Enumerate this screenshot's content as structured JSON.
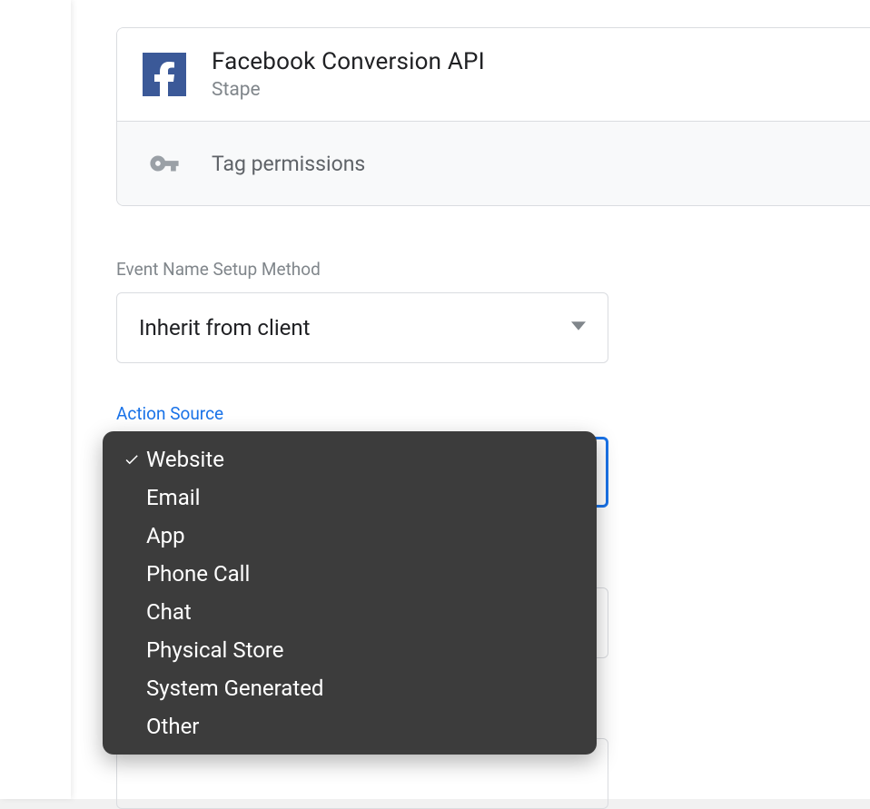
{
  "header": {
    "title": "Facebook Conversion API",
    "subtitle": "Stape",
    "permissions_label": "Tag permissions"
  },
  "event_name_setup": {
    "label": "Event Name Setup Method",
    "value": "Inherit from client"
  },
  "action_source": {
    "label": "Action Source",
    "selected": "Website",
    "options": [
      {
        "label": "Website",
        "selected": true
      },
      {
        "label": "Email",
        "selected": false
      },
      {
        "label": "App",
        "selected": false
      },
      {
        "label": "Phone Call",
        "selected": false
      },
      {
        "label": "Chat",
        "selected": false
      },
      {
        "label": "Physical Store",
        "selected": false
      },
      {
        "label": "System Generated",
        "selected": false
      },
      {
        "label": "Other",
        "selected": false
      }
    ]
  }
}
